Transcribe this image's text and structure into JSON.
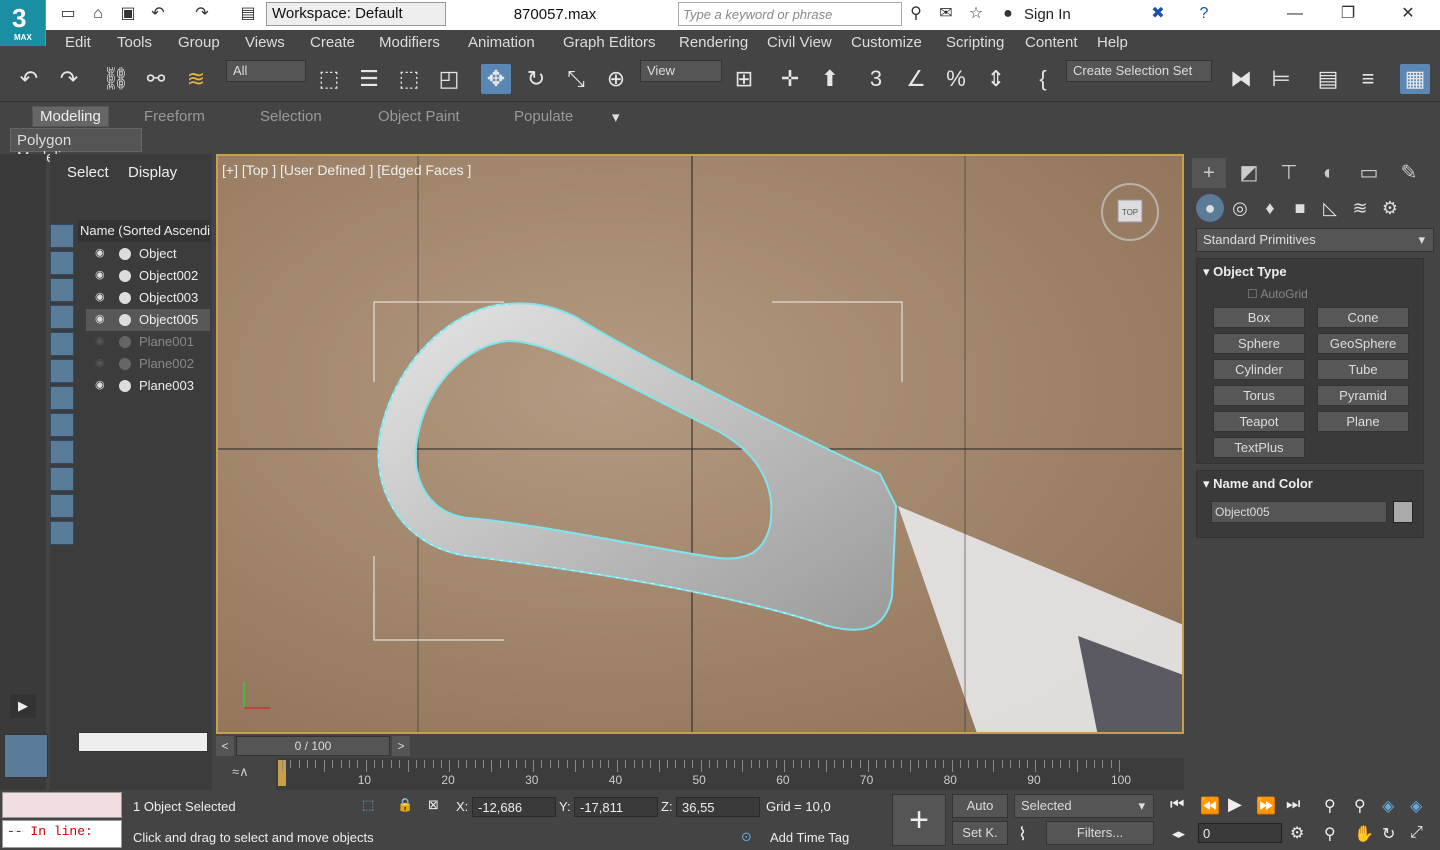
{
  "app": {
    "logo_text": "3",
    "logo_sub": "MAX",
    "file_title": "870057.max"
  },
  "titlebar": {
    "workspace": "Workspace: Default",
    "search_placeholder": "Type a keyword or phrase",
    "sign_in": "Sign In"
  },
  "menu": [
    "Edit",
    "Tools",
    "Group",
    "Views",
    "Create",
    "Modifiers",
    "Animation",
    "Graph Editors",
    "Rendering",
    "Civil View",
    "Customize",
    "Scripting",
    "Content",
    "Help"
  ],
  "toolbar": {
    "filter": "All",
    "ref_coord": "View",
    "selection_set": "Create Selection Set"
  },
  "ribbon": {
    "tabs": [
      "Modeling",
      "Freeform",
      "Selection",
      "Object Paint",
      "Populate"
    ],
    "active_sub": "Polygon Modeling"
  },
  "explorer": {
    "tabs": [
      "Select",
      "Display"
    ],
    "column": "Name (Sorted Ascending)",
    "items": [
      {
        "name": "Object",
        "dim": false,
        "sel": false
      },
      {
        "name": "Object002",
        "dim": false,
        "sel": false
      },
      {
        "name": "Object003",
        "dim": false,
        "sel": false
      },
      {
        "name": "Object005",
        "dim": false,
        "sel": true
      },
      {
        "name": "Plane001",
        "dim": true,
        "sel": false
      },
      {
        "name": "Plane002",
        "dim": true,
        "sel": false
      },
      {
        "name": "Plane003",
        "dim": false,
        "sel": false
      }
    ]
  },
  "viewport": {
    "label": "[+] [Top ] [User Defined ] [Edged Faces ]",
    "viewcube": "TOP"
  },
  "command_panel": {
    "category": "Standard Primitives",
    "object_type_title": "Object Type",
    "autogrid": "AutoGrid",
    "primitives": [
      "Box",
      "Cone",
      "Sphere",
      "GeoSphere",
      "Cylinder",
      "Tube",
      "Torus",
      "Pyramid",
      "Teapot",
      "Plane",
      "TextPlus"
    ],
    "name_color_title": "Name and Color",
    "object_name": "Object005"
  },
  "timeline": {
    "frame": "0 / 100",
    "ticks": [
      "10",
      "20",
      "30",
      "40",
      "50",
      "60",
      "70",
      "80",
      "90",
      "100"
    ]
  },
  "status": {
    "maxscript": "-- In line:",
    "selected": "1 Object Selected",
    "prompt": "Click and drag to select and move objects",
    "x": "-12,686",
    "y": "-17,811",
    "z": "36,55",
    "grid": "Grid = 10,0",
    "add_time_tag": "Add Time Tag",
    "auto": "Auto",
    "setk": "Set K.",
    "selected_dd": "Selected",
    "filters": "Filters...",
    "frame_value": "0"
  }
}
